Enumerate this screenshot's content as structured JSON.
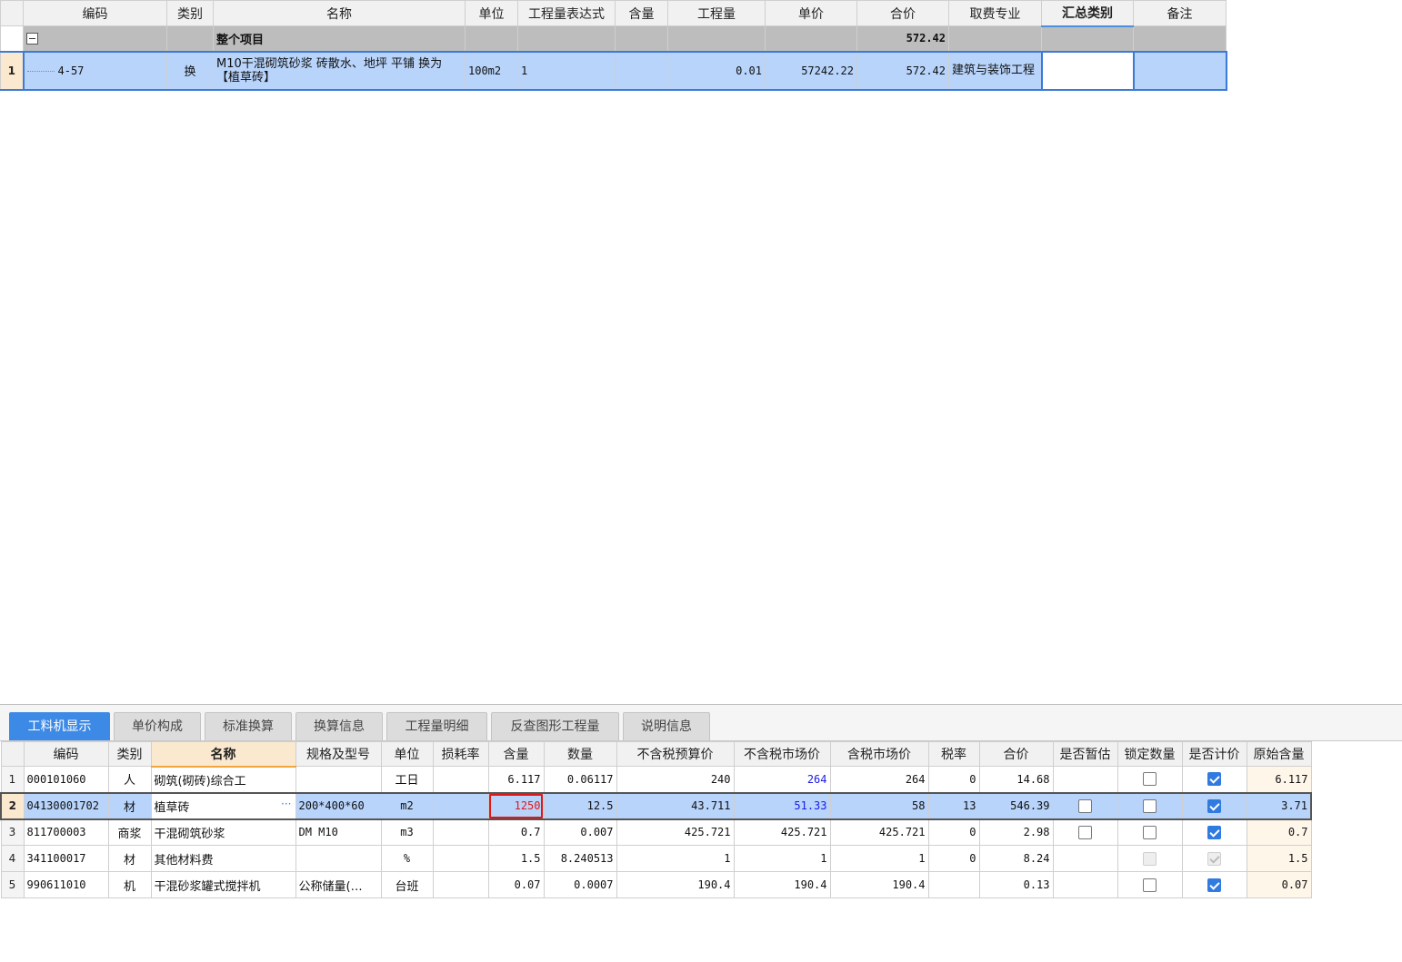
{
  "top_table": {
    "headers": [
      "编码",
      "类别",
      "名称",
      "单位",
      "工程量表达式",
      "含量",
      "工程量",
      "单价",
      "合价",
      "取费专业",
      "汇总类别",
      "备注"
    ],
    "group_row": {
      "name": "整个项目",
      "total": "572.42"
    },
    "rows": [
      {
        "index": "1",
        "code": "4-57",
        "category": "换",
        "name": "M10干混砌筑砂浆 砖散水、地坪 平铺 换为【植草砖】",
        "unit": "100m2",
        "expr": "1",
        "content": "",
        "qty": "0.01",
        "unit_price": "57242.22",
        "total": "572.42",
        "fee": "建筑与装饰工程",
        "summary": "",
        "remark": ""
      }
    ]
  },
  "tabs": [
    "工料机显示",
    "单价构成",
    "标准换算",
    "换算信息",
    "工程量明细",
    "反查图形工程量",
    "说明信息"
  ],
  "bottom_table": {
    "headers": [
      "编码",
      "类别",
      "名称",
      "规格及型号",
      "单位",
      "损耗率",
      "含量",
      "数量",
      "不含税预算价",
      "不含税市场价",
      "含税市场价",
      "税率",
      "合价",
      "是否暂估",
      "锁定数量",
      "是否计价",
      "原始含量"
    ],
    "rows": [
      {
        "index": "1",
        "code": "000101060",
        "category": "人",
        "name": "砌筑(砌砖)综合工",
        "spec": "",
        "unit": "工日",
        "loss": "",
        "content": "6.117",
        "qty": "0.06117",
        "pre": "240",
        "mkt": "264",
        "mkt_tax": "264",
        "tax": "0",
        "total": "14.68",
        "orig": "6.117"
      },
      {
        "index": "2",
        "code": "04130001702",
        "category": "材",
        "name": "植草砖",
        "spec": "200*400*60",
        "unit": "m2",
        "loss": "",
        "content": "1250",
        "qty": "12.5",
        "pre": "43.711",
        "mkt": "51.33",
        "mkt_tax": "58",
        "tax": "13",
        "total": "546.39",
        "orig": "3.71"
      },
      {
        "index": "3",
        "code": "811700003",
        "category": "商浆",
        "name": "干混砌筑砂浆",
        "spec": "DM M10",
        "unit": "m3",
        "loss": "",
        "content": "0.7",
        "qty": "0.007",
        "pre": "425.721",
        "mkt": "425.721",
        "mkt_tax": "425.721",
        "tax": "0",
        "total": "2.98",
        "orig": "0.7"
      },
      {
        "index": "4",
        "code": "341100017",
        "category": "材",
        "name": "其他材料费",
        "spec": "",
        "unit": "%",
        "loss": "",
        "content": "1.5",
        "qty": "8.240513",
        "pre": "1",
        "mkt": "1",
        "mkt_tax": "1",
        "tax": "0",
        "total": "8.24",
        "orig": "1.5"
      },
      {
        "index": "5",
        "code": "990611010",
        "category": "机",
        "name": "干混砂浆罐式搅拌机",
        "spec": "公称储量(…",
        "unit": "台班",
        "loss": "",
        "content": "0.07",
        "qty": "0.0007",
        "pre": "190.4",
        "mkt": "190.4",
        "mkt_tax": "190.4",
        "tax": "",
        "total": "0.13",
        "orig": "0.07"
      }
    ]
  },
  "colors": {
    "accent": "#3d8ae6",
    "highlight_row": "#b8d4fb",
    "group_row": "#bdbdbd",
    "edited_value": "#e01818",
    "market_price": "#1a1ae6"
  }
}
